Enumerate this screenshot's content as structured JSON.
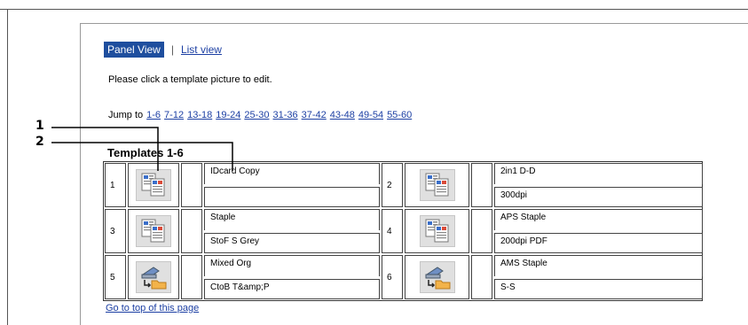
{
  "view": {
    "panel_label": "Panel View",
    "separator": "|",
    "list_label": "List view"
  },
  "instructions": "Please click a template picture to edit.",
  "jump": {
    "label": "Jump to",
    "links": [
      "1-6",
      "7-12",
      "13-18",
      "19-24",
      "25-30",
      "31-36",
      "37-42",
      "43-48",
      "49-54",
      "55-60"
    ]
  },
  "templates_title": "Templates 1-6",
  "callouts": [
    "1",
    "2"
  ],
  "templates": [
    {
      "num": "1",
      "icon": "copy-template-icon",
      "line1": "IDcard Copy",
      "line2": ""
    },
    {
      "num": "2",
      "icon": "copy-template-icon",
      "line1": "2in1 D-D",
      "line2": "300dpi"
    },
    {
      "num": "3",
      "icon": "copy-template-icon",
      "line1": "Staple",
      "line2": "StoF S Grey"
    },
    {
      "num": "4",
      "icon": "copy-template-icon",
      "line1": "APS Staple",
      "line2": "200dpi PDF"
    },
    {
      "num": "5",
      "icon": "scan-to-folder-icon",
      "line1": "Mixed Org",
      "line2": "CtoB T&amp;P"
    },
    {
      "num": "6",
      "icon": "scan-to-folder-icon",
      "line1": "AMS Staple",
      "line2": "S-S"
    }
  ],
  "goto_top": "Go to top of this page"
}
